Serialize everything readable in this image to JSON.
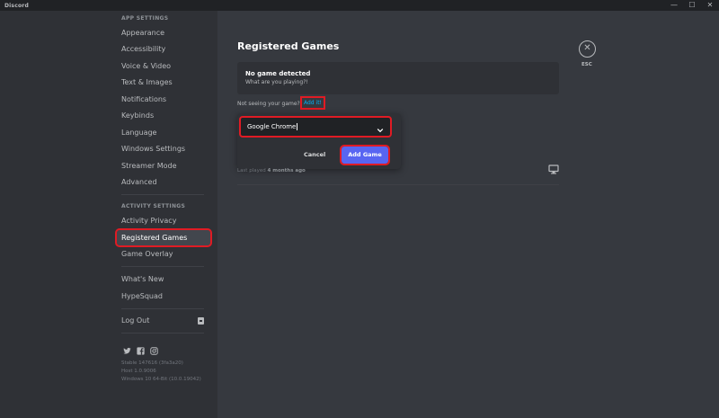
{
  "window": {
    "title": "Discord",
    "minimize": "—",
    "maximize": "☐",
    "close": "✕"
  },
  "sidebar": {
    "app_settings_header": "APP SETTINGS",
    "app_items": [
      "Appearance",
      "Accessibility",
      "Voice & Video",
      "Text & Images",
      "Notifications",
      "Keybinds",
      "Language",
      "Windows Settings",
      "Streamer Mode",
      "Advanced"
    ],
    "activity_settings_header": "ACTIVITY SETTINGS",
    "activity_items": [
      "Activity Privacy",
      "Registered Games",
      "Game Overlay"
    ],
    "misc_items": [
      "What's New",
      "HypeSquad"
    ],
    "logout": "Log Out",
    "version": [
      "Stable 147616 (3fa3a20)",
      "Host 1.0.9006",
      "Windows 10 64-Bit (10.0.19042)"
    ]
  },
  "main": {
    "title": "Registered Games",
    "no_game_title": "No game detected",
    "no_game_subtitle": "What are you playing?!",
    "not_seeing": "Not seeing your game?",
    "add_it": "Add it!",
    "popout": {
      "selected_game": "Google Chrome",
      "cancel": "Cancel",
      "add_game": "Add Game"
    },
    "last_played_label": "Last played",
    "last_played_value": "4 months ago",
    "esc": "ESC",
    "close_glyph": "✕"
  },
  "colors": {
    "background": "#36393f",
    "sidebar": "#2f3136",
    "accent": "#5865f2",
    "link": "#00aff4",
    "highlight": "#e01b24"
  }
}
